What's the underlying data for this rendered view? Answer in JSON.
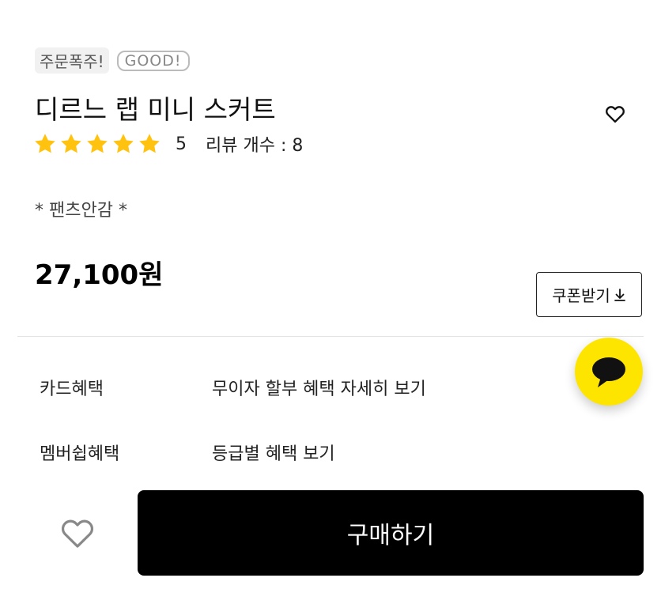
{
  "badges": {
    "hot": "주문폭주!",
    "good": "GOOD!"
  },
  "product": {
    "title": "디르느 랩 미니 스커트",
    "rating_score": "5",
    "review_count": "리뷰 개수 : 8",
    "rating_stars": 5,
    "description": "* 팬츠안감 *",
    "price": "27,100원"
  },
  "coupon": {
    "label": "쿠폰받기"
  },
  "benefits": [
    {
      "label": "카드혜택",
      "value": "무이자 할부 혜택 자세히 보기"
    },
    {
      "label": "멤버쉽혜택",
      "value": "등급별 혜택 보기"
    }
  ],
  "actions": {
    "buy_label": "구매하기"
  },
  "colors": {
    "star": "#ffc20e",
    "kakao": "#fee500",
    "buy_bg": "#000000"
  },
  "icons": {
    "wishlist": "heart-outline-icon",
    "chat": "kakao-chat-icon",
    "download": "download-arrow-icon"
  }
}
